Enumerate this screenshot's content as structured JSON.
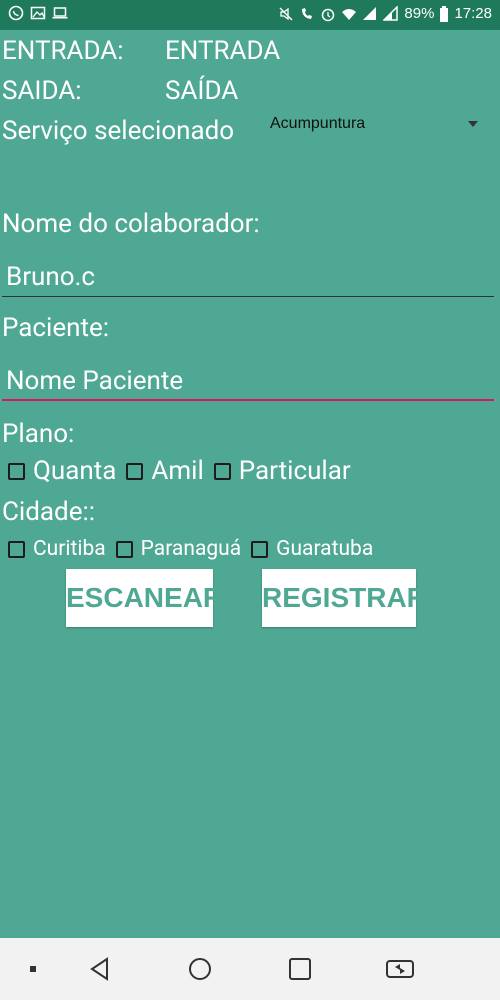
{
  "status_bar": {
    "battery_percent": "89%",
    "time": "17:28",
    "icons": [
      "whatsapp-icon",
      "image-icon",
      "laptop-icon",
      "mute-icon",
      "volte-icon",
      "alarm-icon",
      "wifi-icon",
      "signal-icon",
      "signal-icon",
      "battery-icon"
    ]
  },
  "form": {
    "entrada_label": "ENTRADA:",
    "entrada_value": "ENTRADA",
    "saida_label": "SAIDA:",
    "saida_value": "SAÍDA",
    "servico_label": "Serviço selecionado",
    "servico_value": "Acumpuntura",
    "colaborador_label": "Nome do colaborador:",
    "colaborador_value": "Bruno.c",
    "paciente_label": "Paciente:",
    "paciente_placeholder": "Nome Paciente",
    "plano_label": "Plano:",
    "plano_options": [
      "Quanta",
      "Amil",
      "Particular"
    ],
    "cidade_label": "Cidade::",
    "cidade_options": [
      "Curitiba",
      "Paranaguá",
      "Guaratuba"
    ]
  },
  "buttons": {
    "scan": "ESCANEAR",
    "register": "REGISTRAR"
  },
  "nav_bar": {
    "items": [
      "dot-icon",
      "back-icon",
      "home-icon",
      "recents-icon",
      "screen-rotate-icon"
    ]
  },
  "colors": {
    "background": "#4fa893",
    "status_bar": "#1f7a5c",
    "focus_line": "#d81b60",
    "button_text": "#4fa893"
  }
}
